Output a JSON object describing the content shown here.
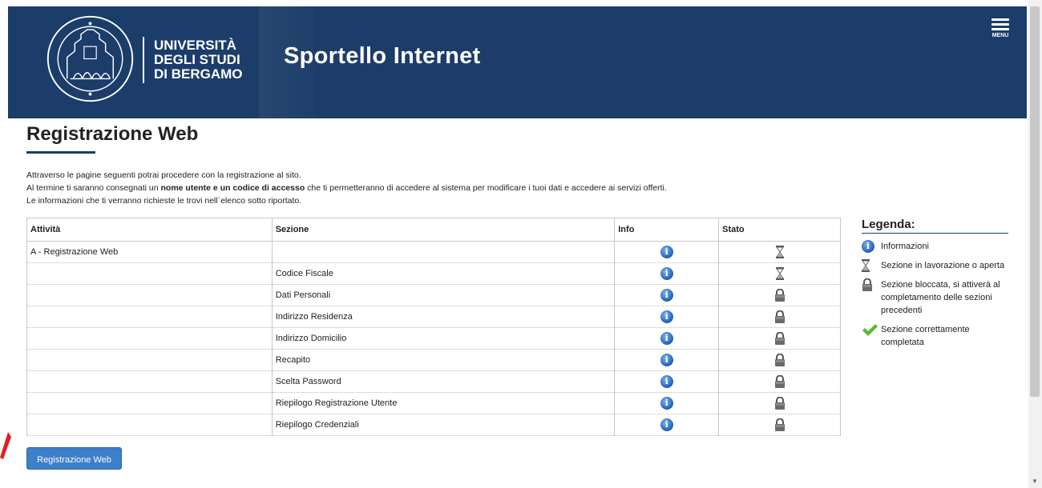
{
  "header": {
    "university_line1": "UNIVERSITÀ",
    "university_line2": "DEGLI STUDI",
    "university_line3": "DI BERGAMO",
    "site_title": "Sportello Internet",
    "menu_label": "MENU",
    "background_color": "#1c3d6a"
  },
  "page": {
    "title": "Registrazione Web",
    "intro_line1": "Attraverso le pagine seguenti potrai procedere con la registrazione al sito.",
    "intro_line2_pre": "Al termine ti saranno consegnati un ",
    "intro_line2_bold": "nome utente e un codice di accesso",
    "intro_line2_post": " che ti permetteranno di accedere al sistema per modificare i tuoi dati e accedere ai servizi offerti.",
    "intro_line3": "Le informazioni che ti verranno richieste le trovi nell`elenco sotto riportato."
  },
  "table": {
    "headers": {
      "activity": "Attività",
      "section": "Sezione",
      "info": "Info",
      "status": "Stato"
    },
    "rows": [
      {
        "activity": "A - Registrazione Web",
        "section": "",
        "status": "hourglass-icon"
      },
      {
        "activity": "",
        "section": "Codice Fiscale",
        "status": "hourglass-icon"
      },
      {
        "activity": "",
        "section": "Dati Personali",
        "status": "lock-icon"
      },
      {
        "activity": "",
        "section": "Indirizzo Residenza",
        "status": "lock-icon"
      },
      {
        "activity": "",
        "section": "Indirizzo Domicilio",
        "status": "lock-icon"
      },
      {
        "activity": "",
        "section": "Recapito",
        "status": "lock-icon"
      },
      {
        "activity": "",
        "section": "Scelta Password",
        "status": "lock-icon"
      },
      {
        "activity": "",
        "section": "Riepilogo Registrazione Utente",
        "status": "lock-icon"
      },
      {
        "activity": "",
        "section": "Riepilogo Credenziali",
        "status": "lock-icon"
      }
    ]
  },
  "legend": {
    "title": "Legenda:",
    "items": [
      {
        "icon": "info-icon",
        "text": "Informazioni"
      },
      {
        "icon": "hourglass-icon",
        "text": "Sezione in lavorazione o aperta"
      },
      {
        "icon": "lock-icon",
        "text": "Sezione bloccata, si attiverà al completamento delle sezioni precedenti"
      },
      {
        "icon": "checkmark-icon",
        "text": "Sezione correttamente completata"
      }
    ]
  },
  "actions": {
    "register_button": "Registrazione Web"
  },
  "colors": {
    "accent": "#1c3d6a",
    "button": "#3d7fc9",
    "info_icon": "#1d5fb5",
    "check_icon": "#5cb82e"
  }
}
